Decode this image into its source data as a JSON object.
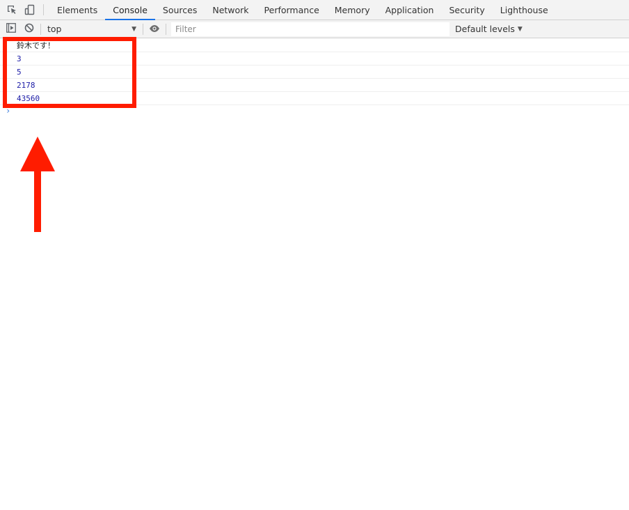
{
  "devtools": {
    "tabs": [
      {
        "label": "Elements"
      },
      {
        "label": "Console"
      },
      {
        "label": "Sources"
      },
      {
        "label": "Network"
      },
      {
        "label": "Performance"
      },
      {
        "label": "Memory"
      },
      {
        "label": "Application"
      },
      {
        "label": "Security"
      },
      {
        "label": "Lighthouse"
      }
    ],
    "active_tab": "Console",
    "accent_color": "#1a73e8"
  },
  "toolbar": {
    "context": "top",
    "filter_placeholder": "Filter",
    "levels_label": "Default levels"
  },
  "console": {
    "messages": [
      {
        "text": "鈴木です！",
        "kind": "string"
      },
      {
        "text": "3",
        "kind": "number"
      },
      {
        "text": "5",
        "kind": "number"
      },
      {
        "text": "2178",
        "kind": "number"
      },
      {
        "text": "43560",
        "kind": "number"
      }
    ],
    "prompt": "›"
  },
  "annotation": {
    "color": "#ff1c00",
    "shapes": [
      "highlight-box",
      "arrow-up"
    ]
  }
}
